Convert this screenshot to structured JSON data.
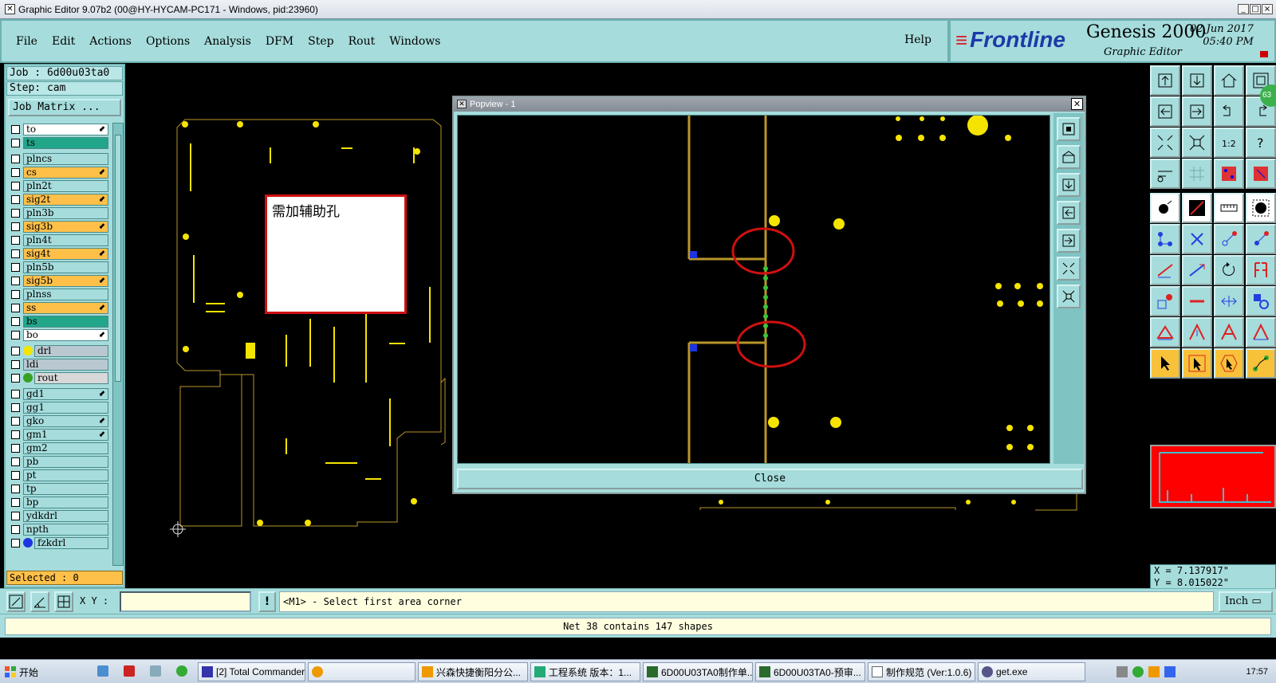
{
  "window": {
    "title": "Graphic Editor 9.07b2 (00@HY-HYCAM-PC171 - Windows, pid:23960)"
  },
  "menu": {
    "items": [
      "File",
      "Edit",
      "Actions",
      "Options",
      "Analysis",
      "DFM",
      "Step",
      "Rout",
      "Windows"
    ],
    "help": "Help"
  },
  "brand": {
    "logo": "Frontline",
    "product": "Genesis 2000",
    "subtitle": "Graphic Editor",
    "date": "02 Jun 2017",
    "time": "05:40 PM"
  },
  "job": {
    "job_line": "Job : 6d00u03ta0",
    "step_line": "Step: cam",
    "matrix_button": "Job Matrix ..."
  },
  "layers": [
    {
      "name": "to",
      "color": "#ffffff",
      "arrow": true
    },
    {
      "name": "ts",
      "color": "#22a68a",
      "arrow": false
    },
    {
      "name": "plncs",
      "color": "#a6dcdc",
      "arrow": false
    },
    {
      "name": "cs",
      "color": "#ffc04a",
      "arrow": true
    },
    {
      "name": "pln2t",
      "color": "#a6dcdc",
      "arrow": false
    },
    {
      "name": "sig2t",
      "color": "#ffc04a",
      "arrow": true
    },
    {
      "name": "pln3b",
      "color": "#a6dcdc",
      "arrow": false
    },
    {
      "name": "sig3b",
      "color": "#ffc04a",
      "arrow": true
    },
    {
      "name": "pln4t",
      "color": "#a6dcdc",
      "arrow": false
    },
    {
      "name": "sig4t",
      "color": "#ffc04a",
      "arrow": true
    },
    {
      "name": "pln5b",
      "color": "#a6dcdc",
      "arrow": false
    },
    {
      "name": "sig5b",
      "color": "#ffc04a",
      "arrow": true
    },
    {
      "name": "plnss",
      "color": "#a6dcdc",
      "arrow": false
    },
    {
      "name": "ss",
      "color": "#ffc04a",
      "arrow": true
    },
    {
      "name": "bs",
      "color": "#22a68a",
      "arrow": false
    },
    {
      "name": "bo",
      "color": "#ffffff",
      "arrow": true
    },
    {
      "name": "drl",
      "color": "#b9c8d0",
      "arrow": false,
      "dot": "#f5e400"
    },
    {
      "name": "ldi",
      "color": "#b9c8d0",
      "arrow": false
    },
    {
      "name": "rout",
      "color": "#d8d8d8",
      "arrow": false,
      "dot": "#3aa020"
    },
    {
      "name": "gd1",
      "color": "#a6dcdc",
      "arrow": true
    },
    {
      "name": "gg1",
      "color": "#a6dcdc",
      "arrow": false
    },
    {
      "name": "gko",
      "color": "#a6dcdc",
      "arrow": true
    },
    {
      "name": "gm1",
      "color": "#a6dcdc",
      "arrow": true
    },
    {
      "name": "gm2",
      "color": "#a6dcdc",
      "arrow": false
    },
    {
      "name": "pb",
      "color": "#a6dcdc",
      "arrow": false
    },
    {
      "name": "pt",
      "color": "#a6dcdc",
      "arrow": false
    },
    {
      "name": "tp",
      "color": "#a6dcdc",
      "arrow": false
    },
    {
      "name": "bp",
      "color": "#a6dcdc",
      "arrow": false
    },
    {
      "name": "ydkdrl",
      "color": "#a6dcdc",
      "arrow": false
    },
    {
      "name": "npth",
      "color": "#a6dcdc",
      "arrow": false
    },
    {
      "name": "fzkdrl",
      "color": "#a6dcdc",
      "arrow": false,
      "dot": "#1d35e0"
    }
  ],
  "selected": "Selected : 0",
  "note": {
    "text": "需加辅助孔"
  },
  "popview": {
    "title": "Popview - 1",
    "close_label": "Close"
  },
  "coords": {
    "x": "X = 7.137917\"",
    "y": "Y = 8.015022\""
  },
  "badge": "63",
  "command": {
    "xy_label": "X Y :",
    "xy_value": "",
    "prompt": "<M1> - Select first area corner",
    "unit": "Inch"
  },
  "status": "Net 38 contains 147 shapes",
  "taskbar": {
    "start": "开始",
    "tasks": [
      "[2] Total Commander...",
      "",
      "兴森快捷衡阳分公...",
      "工程系统  版本：1...",
      "6D00U03TA0制作单...",
      "6D00U03TA0-预审...",
      "制作规范 (Ver:1.0.6)",
      "get.exe"
    ],
    "clock": "17:57"
  },
  "colors": {
    "panel": "#a6dcdc",
    "accent_red": "#d01010",
    "pad_yellow": "#f5e400",
    "trace": "#b8962a"
  }
}
